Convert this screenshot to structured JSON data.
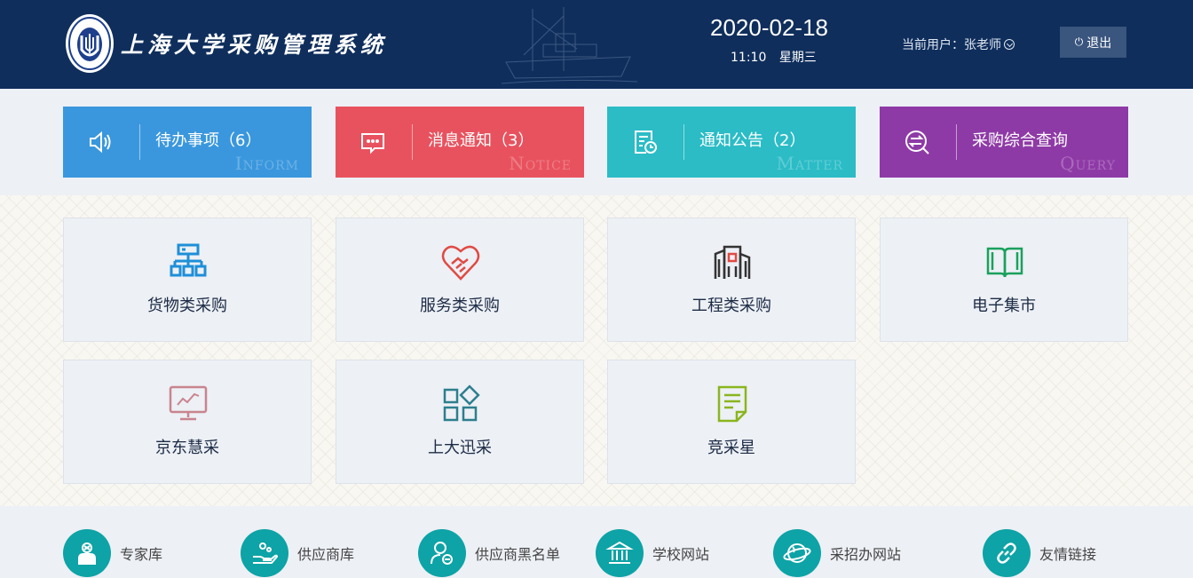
{
  "header": {
    "system_title": "上海大学采购管理系统",
    "date": "2020-02-18",
    "time": "11:10",
    "weekday": "星期三",
    "user_label": "当前用户：张老师",
    "logout_label": "退出",
    "background_color": "#0f2e5c"
  },
  "summary_cards": [
    {
      "label": "待办事项（6）",
      "sub": "Inform",
      "color": "#3a97dd",
      "icon": "speaker-icon"
    },
    {
      "label": "消息通知（3）",
      "sub": "Notice",
      "color": "#e8525e",
      "icon": "chat-bubble-icon"
    },
    {
      "label": "通知公告（2）",
      "sub": "Matter",
      "color": "#2bbcc6",
      "icon": "document-clock-icon"
    },
    {
      "label": "采购综合查询",
      "sub": "Query",
      "color": "#8e3aa6",
      "icon": "exchange-search-icon"
    }
  ],
  "tiles": [
    {
      "label": "货物类采购",
      "icon": "org-chart-icon",
      "color": "#1e8fd8"
    },
    {
      "label": "服务类采购",
      "icon": "handshake-heart-icon",
      "color": "#e04a43"
    },
    {
      "label": "工程类采购",
      "icon": "building-icon",
      "color": "#333333"
    },
    {
      "label": "电子集市",
      "icon": "open-book-icon",
      "color": "#1aa15c"
    },
    {
      "label": "京东慧采",
      "icon": "monitor-chart-icon",
      "color": "#c9848e"
    },
    {
      "label": "上大迅采",
      "icon": "blocks-icon",
      "color": "#2c7f8d"
    },
    {
      "label": "竞采星",
      "icon": "notepad-icon",
      "color": "#8ab51e"
    }
  ],
  "links": [
    {
      "label": "专家库",
      "icon": "expert-icon"
    },
    {
      "label": "供应商库",
      "icon": "supplier-hand-icon"
    },
    {
      "label": "供应商黑名单",
      "icon": "user-minus-icon"
    },
    {
      "label": "学校网站",
      "icon": "institution-icon"
    },
    {
      "label": "采招办网站",
      "icon": "globe-ring-icon"
    },
    {
      "label": "友情链接",
      "icon": "link-icon"
    }
  ],
  "link_color": "#0ea3a6"
}
